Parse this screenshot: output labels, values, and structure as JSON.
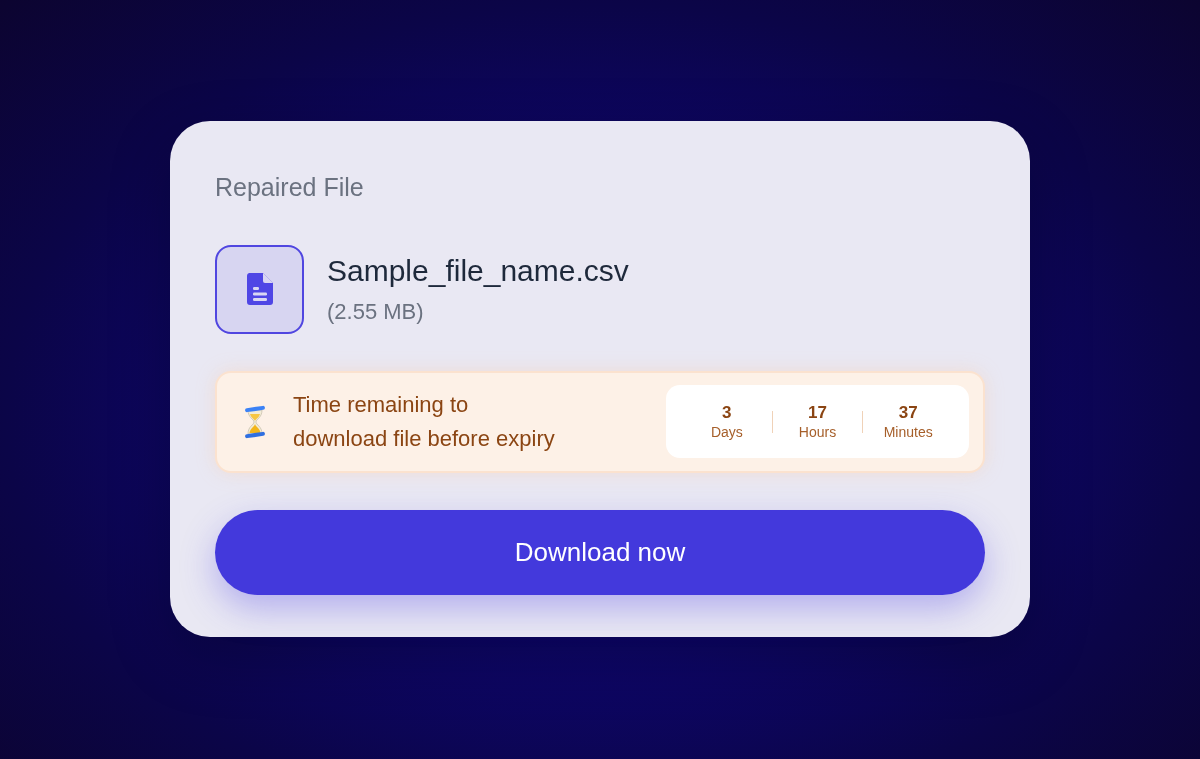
{
  "card": {
    "title": "Repaired File",
    "file": {
      "name": "Sample_file_name.csv",
      "size": "(2.55 MB)"
    },
    "expiry": {
      "message_lines": [
        "Time remaining to",
        "download file before expiry"
      ],
      "countdown": [
        {
          "value": "3",
          "unit": "Days"
        },
        {
          "value": "17",
          "unit": "Hours"
        },
        {
          "value": "37",
          "unit": "Minutes"
        }
      ]
    },
    "download_button": {
      "label": "Download now"
    }
  }
}
